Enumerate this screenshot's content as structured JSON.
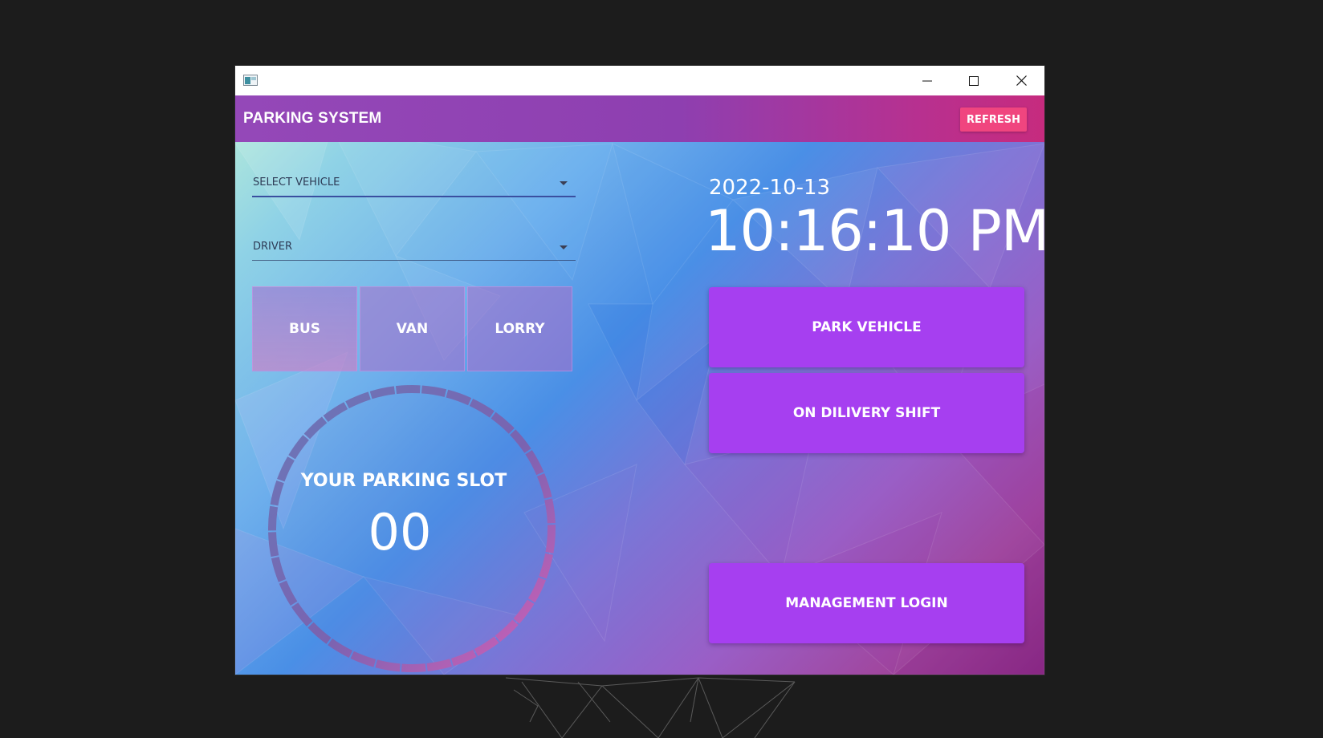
{
  "window": {
    "controls": {
      "minimize": "minimize-icon",
      "maximize": "maximize-icon",
      "close": "close-icon"
    }
  },
  "header": {
    "title": "PARKING SYSTEM",
    "refresh_label": "REFRESH"
  },
  "form": {
    "vehicle_select": {
      "label": "SELECT VEHICLE"
    },
    "driver_select": {
      "label": "DRIVER"
    }
  },
  "vehicle_types": [
    {
      "label": "BUS"
    },
    {
      "label": "VAN"
    },
    {
      "label": "LORRY"
    }
  ],
  "slot": {
    "label": "YOUR PARKING SLOT",
    "number": "00"
  },
  "clock": {
    "date": "2022-10-13",
    "time": "10:16:10 PM"
  },
  "actions": {
    "park": "PARK VEHICLE",
    "delivery": "ON DILIVERY SHIFT",
    "management": "MANAGEMENT LOGIN"
  },
  "colors": {
    "header_start": "#9448b8",
    "header_end": "#c62b7e",
    "refresh_button": "#f0457f",
    "action_button": "#a63ff0",
    "desktop_bg": "#1c1c1c"
  }
}
